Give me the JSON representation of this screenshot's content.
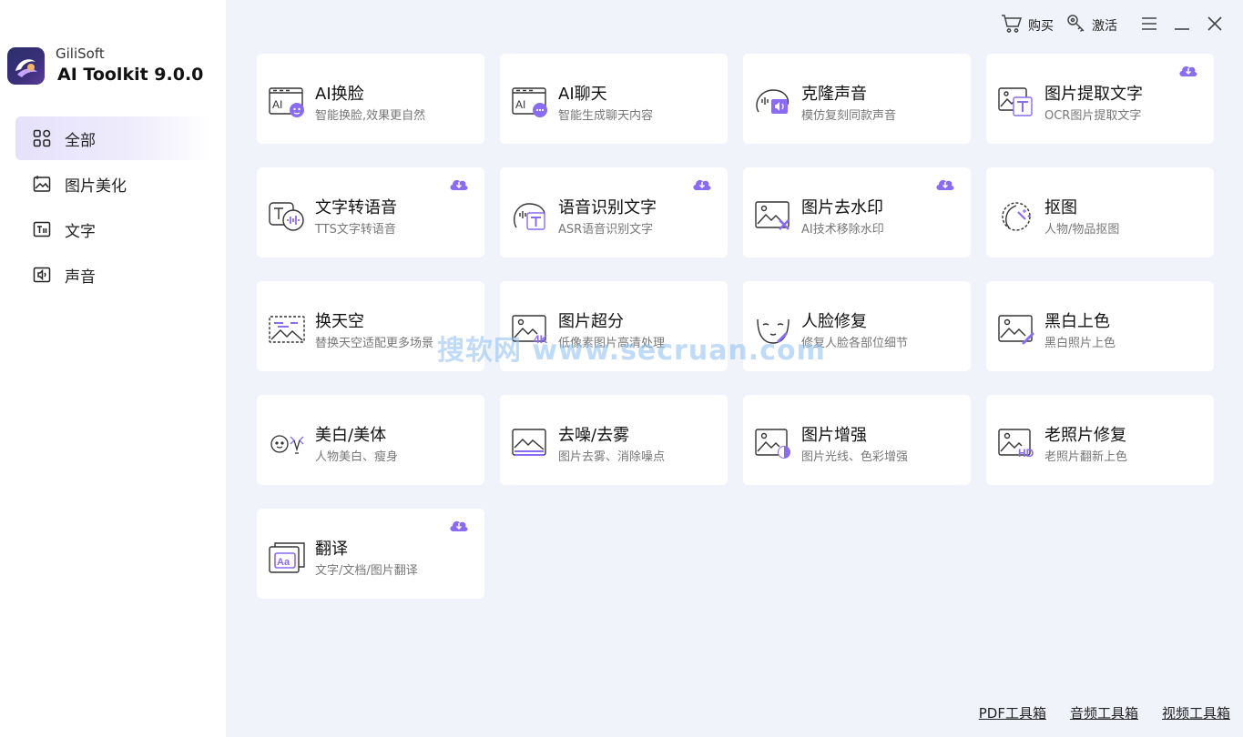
{
  "app": {
    "company": "GiliSoft",
    "product": "AI Toolkit 9.0.0"
  },
  "header": {
    "buy_label": "购买",
    "activate_label": "激活"
  },
  "sidebar": {
    "items": [
      {
        "label": "全部",
        "icon": "grid-icon",
        "active": true
      },
      {
        "label": "图片美化",
        "icon": "image-sparkle-icon",
        "active": false
      },
      {
        "label": "文字",
        "icon": "text-icon",
        "active": false
      },
      {
        "label": "声音",
        "icon": "sound-icon",
        "active": false
      }
    ]
  },
  "tools": [
    {
      "title": "AI换脸",
      "desc": "智能换脸,效果更自然",
      "icon": "face-swap-icon",
      "cloud": false
    },
    {
      "title": "AI聊天",
      "desc": "智能生成聊天内容",
      "icon": "ai-chat-icon",
      "cloud": false
    },
    {
      "title": "克隆声音",
      "desc": "模仿复刻同款声音",
      "icon": "voice-clone-icon",
      "cloud": false
    },
    {
      "title": "图片提取文字",
      "desc": "OCR图片提取文字",
      "icon": "ocr-icon",
      "cloud": true
    },
    {
      "title": "文字转语音",
      "desc": "TTS文字转语音",
      "icon": "tts-icon",
      "cloud": true
    },
    {
      "title": "语音识别文字",
      "desc": "ASR语音识别文字",
      "icon": "asr-icon",
      "cloud": true
    },
    {
      "title": "图片去水印",
      "desc": "AI技术移除水印",
      "icon": "watermark-remove-icon",
      "cloud": true
    },
    {
      "title": "抠图",
      "desc": "人物/物品抠图",
      "icon": "cutout-icon",
      "cloud": false
    },
    {
      "title": "换天空",
      "desc": "替换天空适配更多场景",
      "icon": "sky-replace-icon",
      "cloud": false
    },
    {
      "title": "图片超分",
      "desc": "低像素图片高清处理",
      "icon": "upscale-4k-icon",
      "cloud": false
    },
    {
      "title": "人脸修复",
      "desc": "修复人脸各部位细节",
      "icon": "face-restore-icon",
      "cloud": false
    },
    {
      "title": "黑白上色",
      "desc": "黑白照片上色",
      "icon": "colorize-icon",
      "cloud": false
    },
    {
      "title": "美白/美体",
      "desc": "人物美白、瘦身",
      "icon": "beauty-icon",
      "cloud": false
    },
    {
      "title": "去噪/去雾",
      "desc": "图片去雾、消除噪点",
      "icon": "denoise-icon",
      "cloud": false
    },
    {
      "title": "图片增强",
      "desc": "图片光线、色彩增强",
      "icon": "enhance-icon",
      "cloud": false
    },
    {
      "title": "老照片修复",
      "desc": "老照片翻新上色",
      "icon": "old-photo-hd-icon",
      "cloud": false
    },
    {
      "title": "翻译",
      "desc": "文字/文档/图片翻译",
      "icon": "translate-icon",
      "cloud": true
    }
  ],
  "watermark_text": "搜软网 www.secruan.com",
  "footer": {
    "links": [
      "PDF工具箱",
      "音频工具箱",
      "视频工具箱"
    ]
  },
  "colors": {
    "accent": "#8a6cf0",
    "background": "#f1f3fb",
    "sidebar_active": "#e6e1fb"
  }
}
